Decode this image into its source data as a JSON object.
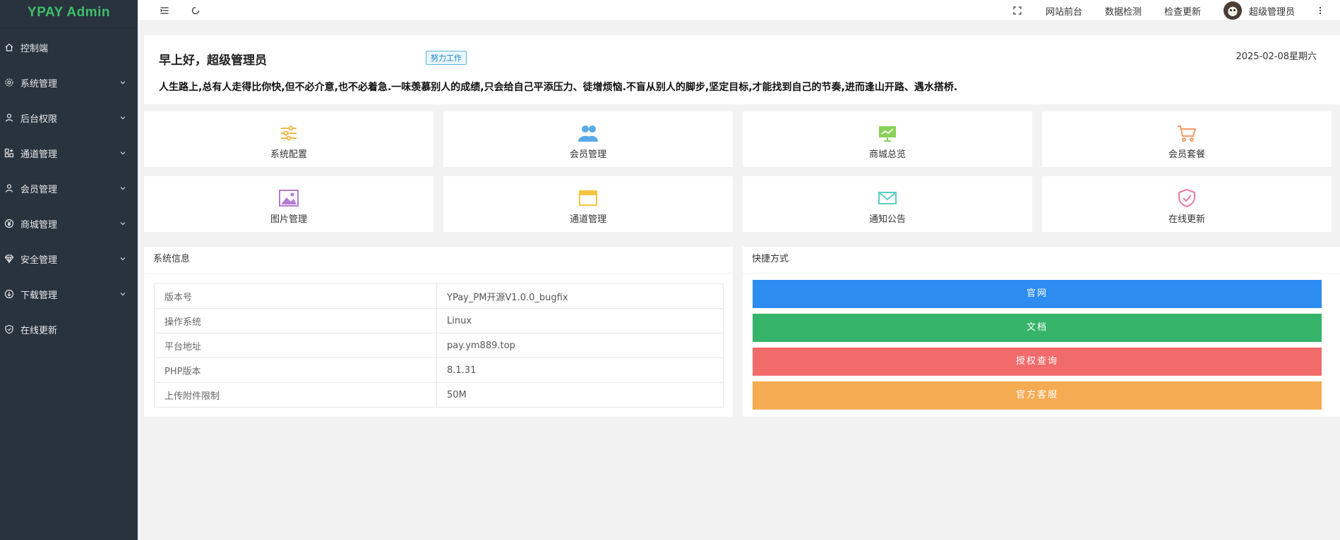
{
  "sidebar": {
    "logo": "YPAY Admin",
    "items": [
      {
        "label": "控制端",
        "icon": "home-icon",
        "has_arrow": false
      },
      {
        "label": "系统管理",
        "icon": "gear-icon",
        "has_arrow": true
      },
      {
        "label": "后台权限",
        "icon": "user-icon",
        "has_arrow": true
      },
      {
        "label": "通道管理",
        "icon": "grid-plus-icon",
        "has_arrow": true
      },
      {
        "label": "会员管理",
        "icon": "user-icon",
        "has_arrow": true
      },
      {
        "label": "商城管理",
        "icon": "yen-icon",
        "has_arrow": true
      },
      {
        "label": "安全管理",
        "icon": "diamond-icon",
        "has_arrow": true
      },
      {
        "label": "下载管理",
        "icon": "download-circle-icon",
        "has_arrow": true
      },
      {
        "label": "在线更新",
        "icon": "shield-check-icon",
        "has_arrow": false
      }
    ]
  },
  "header": {
    "links": [
      "网站前台",
      "数据检测",
      "检查更新"
    ],
    "user_name": "超级管理员"
  },
  "welcome": {
    "greeting": "早上好，超级管理员",
    "badge": "努力工作",
    "date": "2025-02-08星期六",
    "motto": "人生路上,总有人走得比你快,但不必介意,也不必着急.一味羡慕别人的成绩,只会给自己平添压力、徒增烦恼.不盲从别人的脚步,坚定目标,才能找到自己的节奏,进而逢山开路、遇水搭桥."
  },
  "quick_cards": [
    {
      "label": "系统配置",
      "icon": "sliders-icon",
      "color": "#f5b94a"
    },
    {
      "label": "会员管理",
      "icon": "users-icon",
      "color": "#5aaae8"
    },
    {
      "label": "商城总览",
      "icon": "chart-board-icon",
      "color": "#8bd15c"
    },
    {
      "label": "会员套餐",
      "icon": "cart-icon",
      "color": "#f39a6b"
    },
    {
      "label": "图片管理",
      "icon": "image-icon",
      "color": "#b57ad6"
    },
    {
      "label": "通道管理",
      "icon": "window-icon",
      "color": "#f5c542"
    },
    {
      "label": "通知公告",
      "icon": "mail-icon",
      "color": "#5ccfc2"
    },
    {
      "label": "在线更新",
      "icon": "shield-check-icon",
      "color": "#e87ba0"
    }
  ],
  "system_info": {
    "title": "系统信息",
    "rows": [
      {
        "key": "版本号",
        "value": "YPay_PM开源V1.0.0_bugfix"
      },
      {
        "key": "操作系统",
        "value": "Linux"
      },
      {
        "key": "平台地址",
        "value": "pay.ym889.top"
      },
      {
        "key": "PHP版本",
        "value": "8.1.31"
      },
      {
        "key": "上传附件限制",
        "value": "50M"
      }
    ]
  },
  "shortcuts": {
    "title": "快捷方式",
    "buttons": [
      {
        "label": "官网",
        "color": "#2d8cf0"
      },
      {
        "label": "文档",
        "color": "#35b46a"
      },
      {
        "label": "授权查询",
        "color": "#f26b6b"
      },
      {
        "label": "官方客服",
        "color": "#f5ab52"
      }
    ]
  }
}
